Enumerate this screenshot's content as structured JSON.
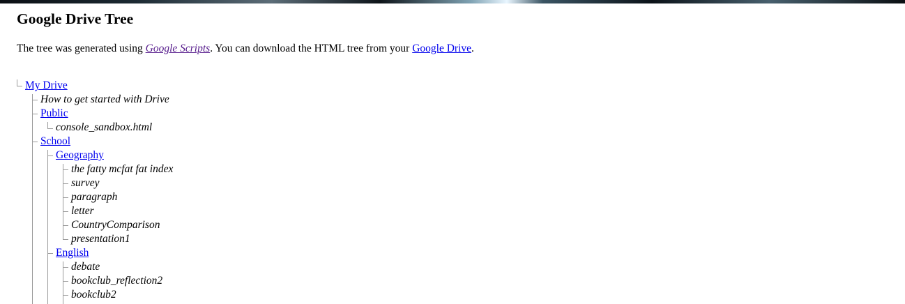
{
  "header": {
    "title": "Google Drive Tree",
    "intro_prefix": "The tree was generated using ",
    "scripts_link": "Google Scripts",
    "intro_middle": ". You can download the HTML tree from your ",
    "drive_link": "Google Drive",
    "intro_suffix": "."
  },
  "tree": {
    "root": "My Drive",
    "items": {
      "how_to": "How to get started with Drive",
      "public": "Public",
      "console_sandbox": "console_sandbox.html",
      "school": "School",
      "geography": "Geography",
      "geo_files": [
        "the fatty mcfat fat index",
        "survey",
        "paragraph",
        "letter",
        "CountryComparison",
        "presentation1"
      ],
      "english": "English",
      "english_files": [
        "debate",
        "bookclub_reflection2",
        "bookclub2"
      ]
    }
  }
}
